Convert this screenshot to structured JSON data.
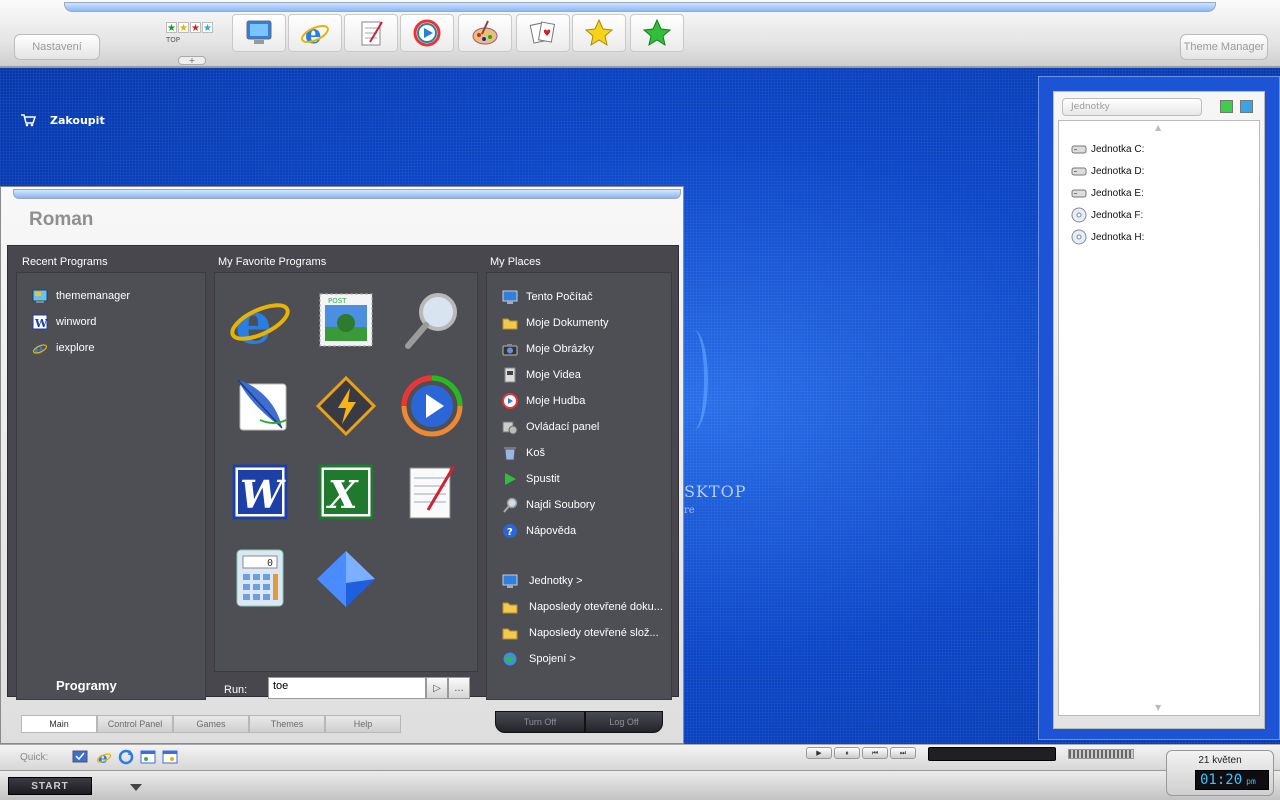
{
  "topbar": {
    "settings_label": "Nastavení",
    "theme_manager_label": "Theme Manager",
    "rating_label": "TOP",
    "plus_label": "+",
    "launchers": [
      {
        "icon": "monitor-icon"
      },
      {
        "icon": "internet-explorer-icon"
      },
      {
        "icon": "notepad-icon"
      },
      {
        "icon": "media-player-icon"
      },
      {
        "icon": "paint-icon"
      },
      {
        "icon": "solitaire-icon"
      },
      {
        "icon": "yellow-star-icon"
      },
      {
        "icon": "green-star-icon"
      }
    ]
  },
  "desktop": {
    "buy_label": "Zakoupit",
    "logo_text": "SKTOP",
    "logo_sub": "re"
  },
  "startmenu": {
    "username": "Roman",
    "recent": {
      "title": "Recent Programs",
      "items": [
        {
          "label": "thememanager",
          "icon": "thememanager-icon"
        },
        {
          "label": "winword",
          "icon": "winword-icon"
        },
        {
          "label": "iexplore",
          "icon": "iexplore-icon"
        }
      ],
      "programs_label": "Programy"
    },
    "favorites": {
      "title": "My Favorite Programs",
      "items": [
        "internet-explorer-icon",
        "outlook-stamp-icon",
        "search-magnifier-icon",
        "feather-icon",
        "winamp-icon",
        "media-player-icon",
        "word-icon",
        "excel-icon",
        "notepad-icon",
        "calculator-icon",
        "blue-pyramid-icon"
      ]
    },
    "places": {
      "title": "My Places",
      "items": [
        {
          "label": "Tento Počítač",
          "icon": "computer-icon"
        },
        {
          "label": "Moje Dokumenty",
          "icon": "documents-folder-icon"
        },
        {
          "label": "Moje Obrázky",
          "icon": "camera-icon"
        },
        {
          "label": "Moje Videa",
          "icon": "video-icon"
        },
        {
          "label": "Moje Hudba",
          "icon": "music-icon"
        },
        {
          "label": "Ovládací panel",
          "icon": "control-panel-icon"
        },
        {
          "label": "Koš",
          "icon": "recycle-bin-icon"
        },
        {
          "label": "Spustit",
          "icon": "run-icon"
        },
        {
          "label": "Najdi Soubory",
          "icon": "search-icon"
        },
        {
          "label": "Nápověda",
          "icon": "help-icon"
        }
      ],
      "extra": [
        {
          "label": "Jednotky >",
          "icon": "drives-icon"
        },
        {
          "label": "Naposledy otevřené doku...",
          "icon": "recent-docs-icon"
        },
        {
          "label": "Naposledy otevřené slož...",
          "icon": "recent-folders-icon"
        },
        {
          "label": "Spojení >",
          "icon": "network-icon"
        }
      ]
    },
    "run": {
      "label": "Run:",
      "value": "toe",
      "go_label": "▷",
      "browse_label": "..."
    },
    "tabs": [
      "Main",
      "Control Panel",
      "Games",
      "Themes",
      "Help"
    ],
    "active_tab": "Main",
    "turn_off_label": "Turn Off",
    "log_off_label": "Log Off"
  },
  "drives": {
    "title": "Jednotky",
    "items": [
      {
        "label": "Jednotka C:",
        "icon": "hard-drive-icon"
      },
      {
        "label": "Jednotka D:",
        "icon": "hard-drive-icon"
      },
      {
        "label": "Jednotka E:",
        "icon": "hard-drive-icon"
      },
      {
        "label": "Jednotka F:",
        "icon": "cd-drive-icon"
      },
      {
        "label": "Jednotka H:",
        "icon": "cd-drive-icon"
      }
    ]
  },
  "taskbar": {
    "quick_label": "Quick:",
    "start_label": "START",
    "date": "21 květen",
    "time": "01:20",
    "ampm": "pm",
    "media_buttons": [
      "▶",
      "⏸",
      "⏮",
      "⏭"
    ]
  },
  "colors": {
    "desktop_blue": "#0b46c7",
    "menu_dark": "#47474d",
    "clock_text": "#39c5ff"
  }
}
